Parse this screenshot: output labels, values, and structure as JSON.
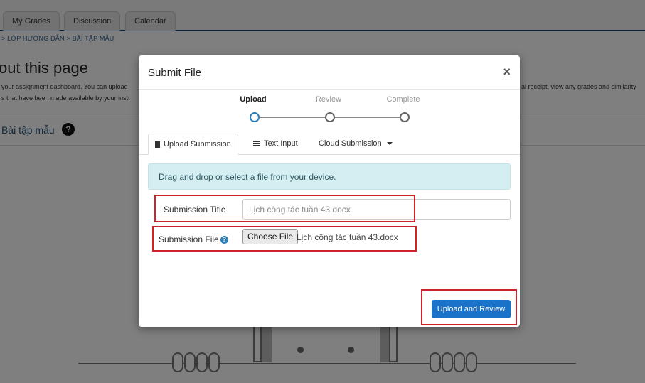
{
  "background": {
    "tabs": [
      "My Grades",
      "Discussion",
      "Calendar"
    ],
    "breadcrumb": "> LỚP HƯỚNG DẪN > BÀI TẬP MẪU",
    "page_title": "out this page",
    "description_line1": "your assignment dashboard. You can upload",
    "description_line1_right": "al receipt, view any grades and similarity",
    "description_line2": "s that have been made available by your instr",
    "assignment_title": "Bài tập mẫu",
    "help_symbol": "?"
  },
  "modal": {
    "title": "Submit File",
    "close_symbol": "×",
    "steps": [
      {
        "label": "Upload",
        "active": true
      },
      {
        "label": "Review",
        "active": false
      },
      {
        "label": "Complete",
        "active": false
      }
    ],
    "tabs": [
      {
        "label": "Upload Submission",
        "icon": "file-icon",
        "active": true
      },
      {
        "label": "Text Input",
        "icon": "text-lines-icon",
        "active": false
      },
      {
        "label": "Cloud Submission",
        "icon": "caret-down-icon",
        "active": false
      }
    ],
    "info_text": "Drag and drop or select a file from your device.",
    "submission_title_label": "Submission Title",
    "submission_title_value": "Lịch công tác tuần 43.docx",
    "submission_file_label": "Submission File",
    "help_symbol": "?",
    "choose_file_label": "Choose File",
    "file_name": "Lịch công tác tuần 43.docx",
    "primary_button": "Upload and Review"
  },
  "colors": {
    "primary_button": "#1a73c8",
    "info_box": "#d5eef2",
    "annotation_box": "#d0202a",
    "active_step": "#2d7fb8"
  }
}
